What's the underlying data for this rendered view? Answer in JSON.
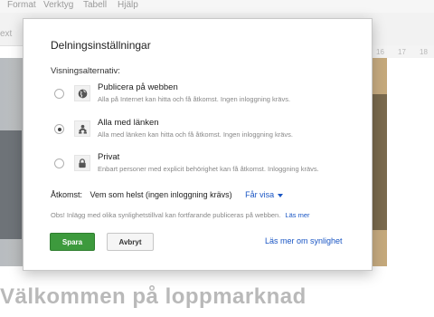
{
  "menu": [
    "Format",
    "Verktyg",
    "Tabell",
    "Hjälp"
  ],
  "toolbar": {
    "text_fragment": "ext",
    "ruler_numbers": [
      "16",
      "17",
      "18"
    ]
  },
  "page": {
    "welcome_heading": "Välkommen på loppmarknad"
  },
  "dialog": {
    "title": "Delningsinställningar",
    "visibility_label": "Visningsalternativ:",
    "options": [
      {
        "title": "Publicera på webben",
        "description": "Alla på Internet kan hitta och få åtkomst. Ingen inloggning krävs.",
        "icon": "globe-icon",
        "selected": false
      },
      {
        "title": "Alla med länken",
        "description": "Alla med länken kan hitta och få åtkomst. Ingen inloggning krävs.",
        "icon": "people-icon",
        "selected": true
      },
      {
        "title": "Privat",
        "description": "Enbart personer med explicit behörighet kan få åtkomst. Inloggning krävs.",
        "icon": "lock-icon",
        "selected": false
      }
    ],
    "access": {
      "label": "Åtkomst:",
      "value": "Vem som helst (ingen inloggning krävs)",
      "dropdown": "Får visa"
    },
    "notice": {
      "text": "Obs! Inlägg med olika synlighetstillval kan fortfarande publiceras på webben.",
      "link": "Läs mer"
    },
    "buttons": {
      "save": "Spara",
      "cancel": "Avbryt"
    },
    "learn_more": "Läs mer om synlighet"
  },
  "colors": {
    "accent_green": "#3d9a3d",
    "link_blue": "#1a56c4"
  }
}
